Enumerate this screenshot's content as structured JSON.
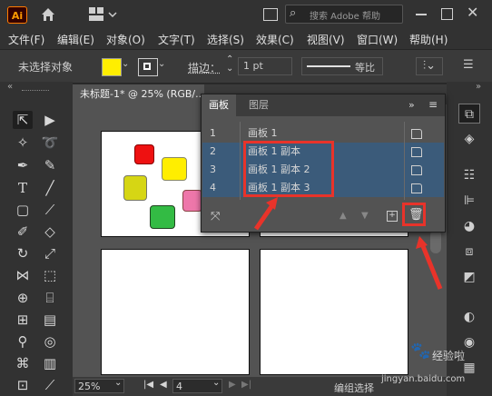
{
  "app": {
    "logo_text": "Ai",
    "search_placeholder": "搜索 Adobe 帮助"
  },
  "menu": [
    "文件(F)",
    "编辑(E)",
    "对象(O)",
    "文字(T)",
    "选择(S)",
    "效果(C)",
    "视图(V)",
    "窗口(W)",
    "帮助(H)"
  ],
  "control_bar": {
    "no_selection": "未选择对象",
    "stroke_label": "描边：",
    "stroke_value": "1 pt",
    "stroke_style": "等比",
    "fill_color": "#ffee00"
  },
  "document": {
    "tab_title": "未标题-1* @ 25% (RGB/..."
  },
  "status": {
    "zoom": "25%",
    "page": "4",
    "tool_hint": "编组选择"
  },
  "panel": {
    "tabs": [
      "画板",
      "图层"
    ],
    "rows": [
      {
        "num": "1",
        "name": "画板 1",
        "selected": false
      },
      {
        "num": "2",
        "name": "画板 1 副本",
        "selected": true
      },
      {
        "num": "3",
        "name": "画板 1 副本 2",
        "selected": true
      },
      {
        "num": "4",
        "name": "画板 1 副本 3",
        "selected": true
      }
    ]
  },
  "watermark": {
    "text1": "经验啦",
    "text2": "jingyan.baidu.com"
  },
  "colors": {
    "accent_red": "#e8332a",
    "selected_row": "#3b5b7a"
  }
}
